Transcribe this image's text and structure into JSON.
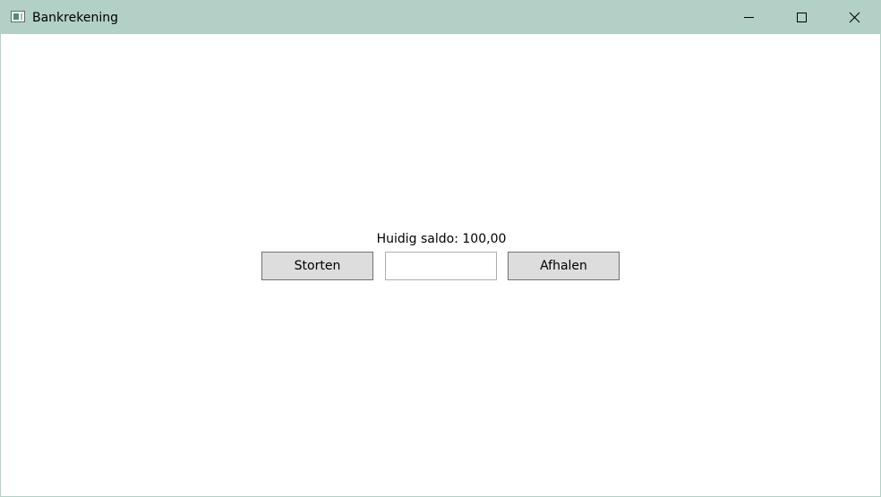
{
  "window": {
    "title": "Bankrekening",
    "app_icon": "window-app-icon",
    "controls": {
      "minimize_icon": "minimize-icon",
      "maximize_icon": "maximize-icon",
      "close_icon": "close-icon"
    }
  },
  "main": {
    "balance_text": "Huidig saldo: 100,00",
    "deposit_label": "Storten",
    "withdraw_label": "Afhalen",
    "amount_value": "",
    "amount_placeholder": ""
  },
  "colors": {
    "titlebar": "#b3d0c7",
    "button_face": "#dddddd",
    "button_border": "#707070",
    "input_border": "#abadb3"
  }
}
